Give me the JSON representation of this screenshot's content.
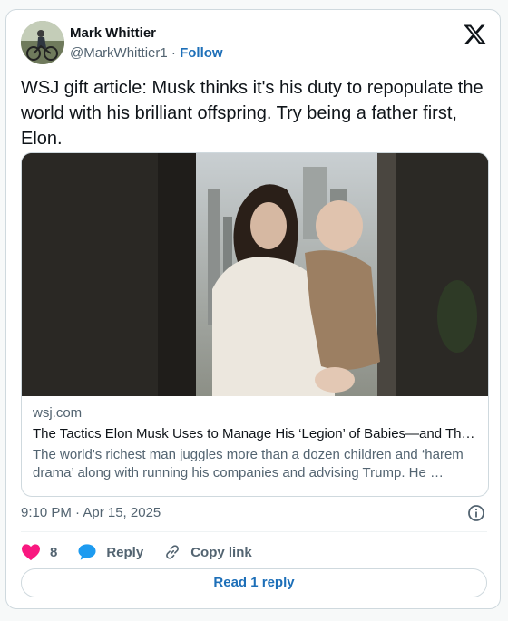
{
  "author": {
    "name": "Mark Whittier",
    "handle": "@MarkWhittier1",
    "separator": "·",
    "follow_label": "Follow"
  },
  "tweet": {
    "text": "WSJ gift article:  Musk thinks it's his duty to repopulate the world with his brilliant offspring. Try being a father first, Elon."
  },
  "link_card": {
    "domain": "wsj.com",
    "title": "The Tactics Elon Musk Uses to Manage His ‘Legion’ of Babies—and Th…",
    "description": "The world's richest man juggles more than a dozen children and ‘harem drama’ along with running his companies and advising Trump. He …"
  },
  "meta": {
    "timestamp": "9:10 PM · Apr 15, 2025"
  },
  "actions": {
    "like_count": "8",
    "reply_label": "Reply",
    "copy_link_label": "Copy link"
  },
  "footer": {
    "read_reply_label": "Read 1 reply"
  },
  "icons": {
    "logo": "x-logo-icon",
    "info": "info-icon",
    "like": "heart-icon",
    "reply": "speech-bubble-icon",
    "copy": "link-icon"
  },
  "colors": {
    "like_pink": "#f91880",
    "reply_blue": "#1d9bf0",
    "link_blue": "#1d6fb8",
    "muted_text": "#536471",
    "border": "#cfd9de"
  }
}
